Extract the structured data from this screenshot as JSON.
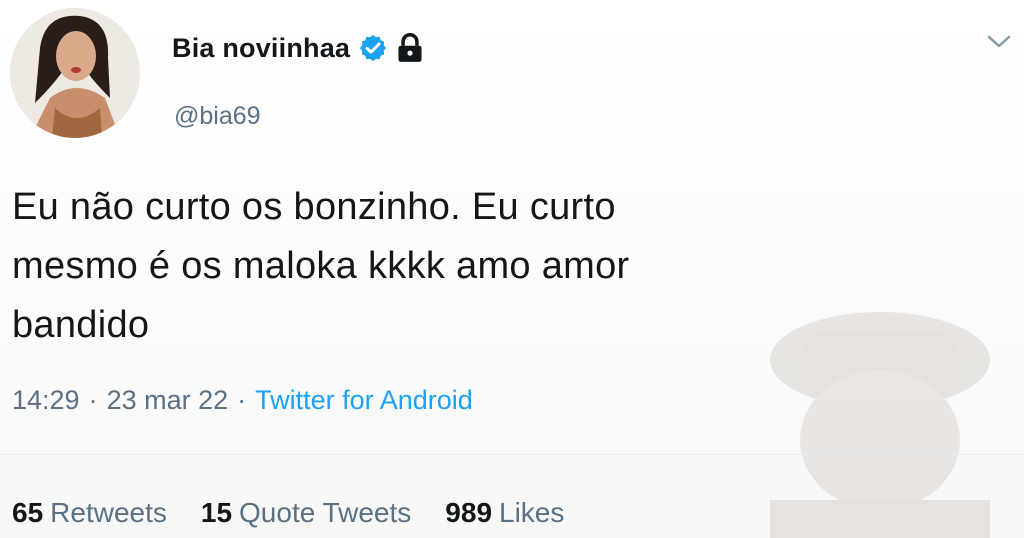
{
  "user": {
    "display_name": "Bia noviinhaa",
    "handle": "@bia69"
  },
  "tweet": {
    "text_lines": [
      "Eu não curto os bonzinho. Eu curto",
      "mesmo é os maloka kkkk amo amor",
      "bandido"
    ],
    "time": "14:29",
    "date": "23 mar 22",
    "separator": "·",
    "source": "Twitter for Android"
  },
  "stats": {
    "retweets": {
      "count": "65",
      "label": "Retweets"
    },
    "quote_tweets": {
      "count": "15",
      "label": "Quote Tweets"
    },
    "likes": {
      "count": "989",
      "label": "Likes"
    }
  },
  "icons": {
    "verified": "verified-badge-icon",
    "lock": "lock-icon",
    "more": "chevron-down-icon"
  },
  "colors": {
    "text": "#14171a",
    "secondary": "#5b7083",
    "link": "#1da1f2",
    "verified": "#1da1f2"
  }
}
